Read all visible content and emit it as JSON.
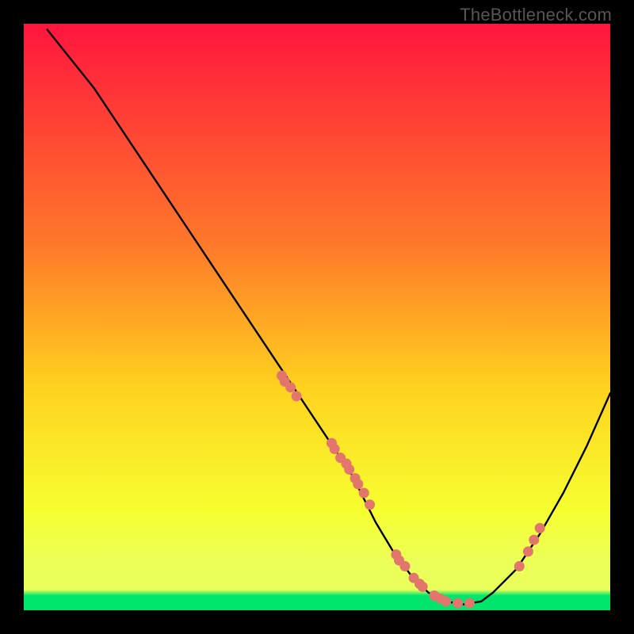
{
  "watermark": "TheBottleneck.com",
  "colors": {
    "gradient_top": "#ff153e",
    "gradient_mid1": "#ff7a2a",
    "gradient_mid2": "#ffd21f",
    "gradient_mid3": "#f6ff30",
    "gradient_bottom_band": "#ebff5a",
    "gradient_green": "#00e66c",
    "curve": "#000000",
    "dot": "#e2766d"
  },
  "chart_data": {
    "type": "line",
    "title": "",
    "xlabel": "",
    "ylabel": "",
    "xlim": [
      0,
      100
    ],
    "ylim": [
      0,
      100
    ],
    "series": [
      {
        "name": "curve",
        "x": [
          4,
          8,
          12,
          16,
          20,
          24,
          28,
          32,
          36,
          40,
          44,
          48,
          52,
          56,
          58,
          60,
          63,
          66,
          69,
          72,
          75,
          78,
          80,
          84,
          88,
          92,
          96,
          100
        ],
        "values": [
          99,
          94,
          89,
          83,
          77,
          71,
          65,
          59,
          53,
          47,
          41,
          35,
          29,
          23,
          19,
          15,
          10,
          6,
          3,
          1.5,
          1,
          1.5,
          3,
          7,
          13,
          20,
          28,
          37
        ]
      }
    ],
    "markers": {
      "name": "highlight-dots",
      "x": [
        44,
        44.5,
        45.5,
        46.5,
        52.5,
        53,
        54,
        55,
        55.5,
        56.5,
        57,
        58,
        59,
        63.5,
        64,
        65,
        66.5,
        67.5,
        68,
        70,
        71,
        72,
        74,
        76,
        84.5,
        86,
        87,
        88
      ],
      "values": [
        40,
        39,
        38,
        36.5,
        28.5,
        27.5,
        26,
        25,
        24,
        22.5,
        21.5,
        20,
        18,
        9.5,
        8.5,
        7.5,
        5.5,
        4.5,
        4,
        2.5,
        2,
        1.5,
        1.2,
        1.2,
        7.5,
        10,
        12,
        14
      ]
    }
  }
}
